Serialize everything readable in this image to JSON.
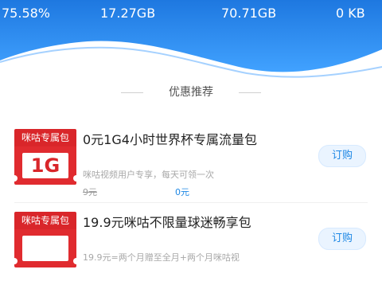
{
  "header": {
    "stats": [
      "75.58%",
      "17.27GB",
      "70.71GB",
      "0 KB"
    ],
    "colors": {
      "top": "#1e78e0",
      "bottom": "#41a2ff"
    }
  },
  "section": {
    "title": "优惠推荐"
  },
  "offers": [
    {
      "badge": "咪咕专属包",
      "badge_big": "1G",
      "title": "0元1G4小时世界杯专属流量包",
      "desc": "咪咕视频用户专享，每天可领一次",
      "old_price": "9元",
      "new_price": "0元",
      "button": "订购"
    },
    {
      "badge": "咪咕专属包",
      "badge_big": "",
      "title": "19.9元咪咕不限量球迷畅享包",
      "desc": "19.9元=两个月赠至全月+两个月咪咕视",
      "old_price": "",
      "new_price": "",
      "button": "订购"
    }
  ]
}
